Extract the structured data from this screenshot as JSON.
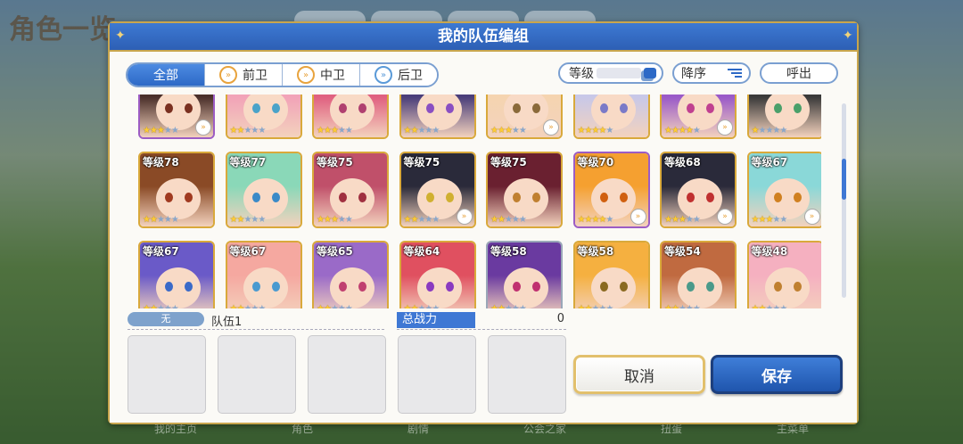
{
  "background": {
    "title_text": "角色一览",
    "bottom_nav": [
      "我的主页",
      "角色",
      "剧情",
      "公会之家",
      "扭蛋",
      "主菜单"
    ]
  },
  "dialog": {
    "title": "我的队伍编组",
    "filters": [
      {
        "label": "全部",
        "active": true,
        "icon": ""
      },
      {
        "label": "前卫",
        "active": false,
        "icon": "front-position-icon"
      },
      {
        "label": "中卫",
        "active": false,
        "icon": "middle-position-icon"
      },
      {
        "label": "后卫",
        "active": false,
        "icon": "back-position-icon"
      }
    ],
    "sort_label": "等级",
    "order_label": "降序",
    "call_label": "呼出",
    "characters": [
      {
        "level": "",
        "stars": 3,
        "border": "purple",
        "hair": "#4a2f2a",
        "eye": "#7a3020",
        "rank": true
      },
      {
        "level": "",
        "stars": 2,
        "border": "gold",
        "hair": "#f2a3b8",
        "eye": "#4aa3c9",
        "rank": false
      },
      {
        "level": "",
        "stars": 3,
        "border": "gold",
        "hair": "#e06080",
        "eye": "#b04070",
        "rank": false
      },
      {
        "level": "",
        "stars": 2,
        "border": "gold",
        "hair": "#4a3e7a",
        "eye": "#8a4fc2",
        "rank": false
      },
      {
        "level": "",
        "stars": 3,
        "border": "gold",
        "hair": "#f5d4b0",
        "eye": "#8a6a3a",
        "rank": true
      },
      {
        "level": "",
        "stars": 4,
        "border": "gold",
        "hair": "#c8c8e8",
        "eye": "#7a7ac8",
        "rank": false
      },
      {
        "level": "",
        "stars": 4,
        "border": "gold",
        "hair": "#9a5ac8",
        "eye": "#c04090",
        "rank": true
      },
      {
        "level": "",
        "stars": 1,
        "border": "gold",
        "hair": "#3a3a3a",
        "eye": "#4aa06a",
        "rank": false
      },
      {
        "level": "等级78",
        "stars": 2,
        "border": "gold",
        "hair": "#8a4a26",
        "eye": "#a03a20",
        "rank": false
      },
      {
        "level": "等级77",
        "stars": 2,
        "border": "gold",
        "hair": "#8ad8b8",
        "eye": "#3a8ac8",
        "rank": false
      },
      {
        "level": "等级75",
        "stars": 3,
        "border": "gold",
        "hair": "#c0506a",
        "eye": "#a03040",
        "rank": false
      },
      {
        "level": "等级75",
        "stars": 2,
        "border": "gold",
        "hair": "#2a2a3a",
        "eye": "#d0b030",
        "rank": true
      },
      {
        "level": "等级75",
        "stars": 2,
        "border": "gold",
        "hair": "#6a2030",
        "eye": "#c08030",
        "rank": false
      },
      {
        "level": "等级70",
        "stars": 4,
        "border": "purple",
        "hair": "#f5a030",
        "eye": "#d06010",
        "rank": true
      },
      {
        "level": "等级68",
        "stars": 3,
        "border": "gold",
        "hair": "#2a2a3a",
        "eye": "#c03030",
        "rank": true
      },
      {
        "level": "等级67",
        "stars": 3,
        "border": "gold",
        "hair": "#8ad8d8",
        "eye": "#d08020",
        "rank": true
      },
      {
        "level": "等级67",
        "stars": 2,
        "border": "gold",
        "hair": "#6a5ac8",
        "eye": "#3a6ac8",
        "rank": false
      },
      {
        "level": "等级67",
        "stars": 2,
        "border": "gold",
        "hair": "#f5a8a0",
        "eye": "#4a9ad0",
        "rank": false
      },
      {
        "level": "等级65",
        "stars": 2,
        "border": "gold",
        "hair": "#9a6ac8",
        "eye": "#c04070",
        "rank": false
      },
      {
        "level": "等级64",
        "stars": 2,
        "border": "gold",
        "hair": "#e05060",
        "eye": "#8a3ac0",
        "rank": false
      },
      {
        "level": "等级58",
        "stars": 2,
        "border": "silver",
        "hair": "#6a3aa0",
        "eye": "#c03070",
        "rank": false
      },
      {
        "level": "等级58",
        "stars": 2,
        "border": "gold",
        "hair": "#f5b040",
        "eye": "#8a6a20",
        "rank": false
      },
      {
        "level": "等级54",
        "stars": 2,
        "border": "gold",
        "hair": "#c06a40",
        "eye": "#4a9a8a",
        "rank": false
      },
      {
        "level": "等级48",
        "stars": 2,
        "border": "gold",
        "hair": "#f5b0c0",
        "eye": "#c08030",
        "rank": false
      }
    ],
    "team_tag": "无",
    "team_name": "队伍1",
    "power_label": "总战力",
    "power_value": "0",
    "cancel_label": "取消",
    "save_label": "保存",
    "colors": {
      "header": "#3d79d3",
      "accent_gold": "#c9a64e",
      "save": "#2d69c6"
    }
  }
}
